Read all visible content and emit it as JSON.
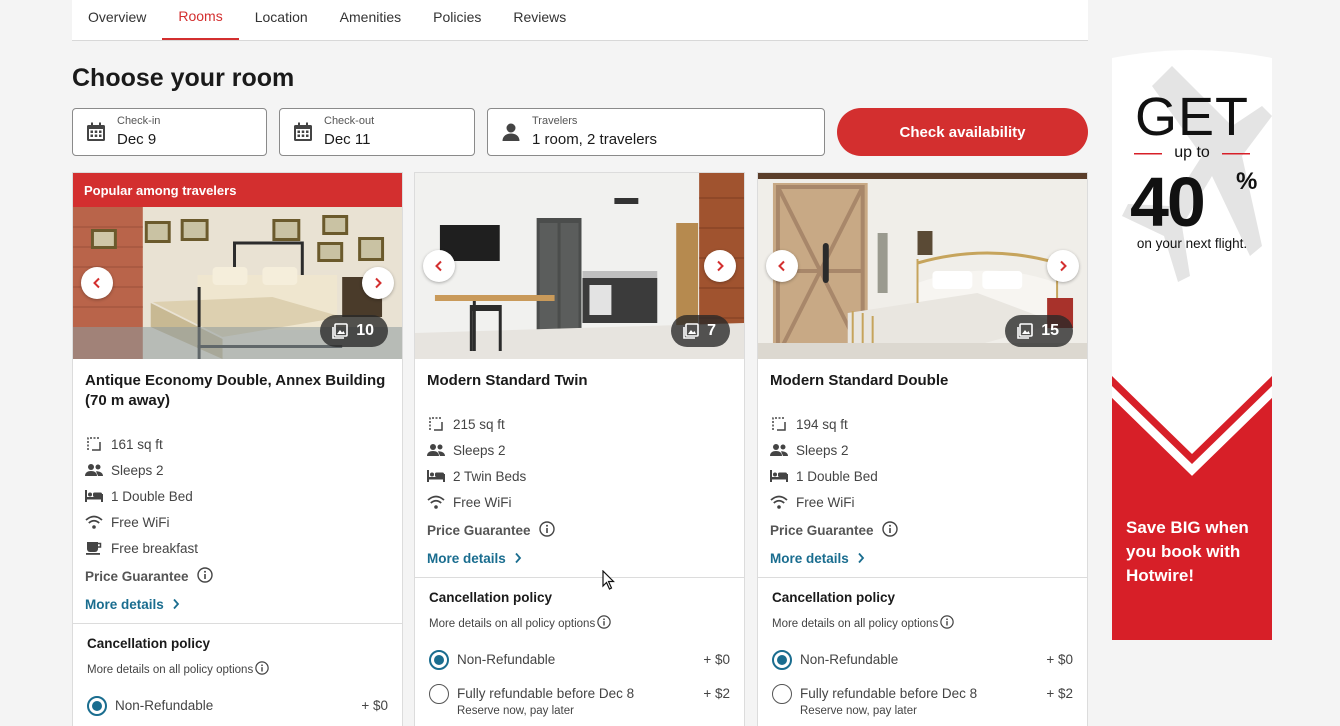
{
  "tabs": [
    "Overview",
    "Rooms",
    "Location",
    "Amenities",
    "Policies",
    "Reviews"
  ],
  "active_tab": "Rooms",
  "page_title": "Choose your room",
  "search": {
    "checkin": {
      "label": "Check-in",
      "value": "Dec 9"
    },
    "checkout": {
      "label": "Check-out",
      "value": "Dec 11"
    },
    "travelers": {
      "label": "Travelers",
      "value": "1 room, 2 travelers"
    },
    "button": "Check availability"
  },
  "rooms": [
    {
      "badge": "Popular among travelers",
      "photo_count": "10",
      "name": "Antique Economy Double, Annex Building (70 m away)",
      "features": [
        {
          "icon": "area-icon",
          "text": "161 sq ft"
        },
        {
          "icon": "people-icon",
          "text": "Sleeps 2"
        },
        {
          "icon": "bed-icon",
          "text": "1 Double Bed"
        },
        {
          "icon": "wifi-icon",
          "text": "Free WiFi"
        },
        {
          "icon": "coffee-icon",
          "text": "Free breakfast"
        }
      ],
      "price_guarantee": "Price Guarantee",
      "more_details": "More details",
      "cancellation_title": "Cancellation policy",
      "cancellation_more": "More details on all policy options",
      "options": [
        {
          "label": "Non-Refundable",
          "price": "+ $0",
          "sub": "",
          "checked": true
        }
      ]
    },
    {
      "badge": "",
      "photo_count": "7",
      "name": "Modern Standard Twin",
      "features": [
        {
          "icon": "area-icon",
          "text": "215 sq ft"
        },
        {
          "icon": "people-icon",
          "text": "Sleeps 2"
        },
        {
          "icon": "bed-icon",
          "text": "2 Twin Beds"
        },
        {
          "icon": "wifi-icon",
          "text": "Free WiFi"
        }
      ],
      "price_guarantee": "Price Guarantee",
      "more_details": "More details",
      "cancellation_title": "Cancellation policy",
      "cancellation_more": "More details on all policy options",
      "options": [
        {
          "label": "Non-Refundable",
          "price": "+ $0",
          "sub": "",
          "checked": true
        },
        {
          "label": "Fully refundable before Dec 8",
          "price": "+ $2",
          "sub": "Reserve now, pay later",
          "checked": false
        }
      ]
    },
    {
      "badge": "",
      "photo_count": "15",
      "name": "Modern Standard Double",
      "features": [
        {
          "icon": "area-icon",
          "text": "194 sq ft"
        },
        {
          "icon": "people-icon",
          "text": "Sleeps 2"
        },
        {
          "icon": "bed-icon",
          "text": "1 Double Bed"
        },
        {
          "icon": "wifi-icon",
          "text": "Free WiFi"
        }
      ],
      "price_guarantee": "Price Guarantee",
      "more_details": "More details",
      "cancellation_title": "Cancellation policy",
      "cancellation_more": "More details on all policy options",
      "options": [
        {
          "label": "Non-Refundable",
          "price": "+ $0",
          "sub": "",
          "checked": true
        },
        {
          "label": "Fully refundable before Dec 8",
          "price": "+ $2",
          "sub": "Reserve now, pay later",
          "checked": false
        }
      ]
    }
  ],
  "ad": {
    "get": "GET",
    "up_to": "up to",
    "amount": "40",
    "percent": "%",
    "next_flight": "on your next flight.",
    "save": "Save BIG when you book with Hotwire!"
  },
  "colors": {
    "accent": "#d32f2f",
    "link": "#1a6d8f"
  }
}
